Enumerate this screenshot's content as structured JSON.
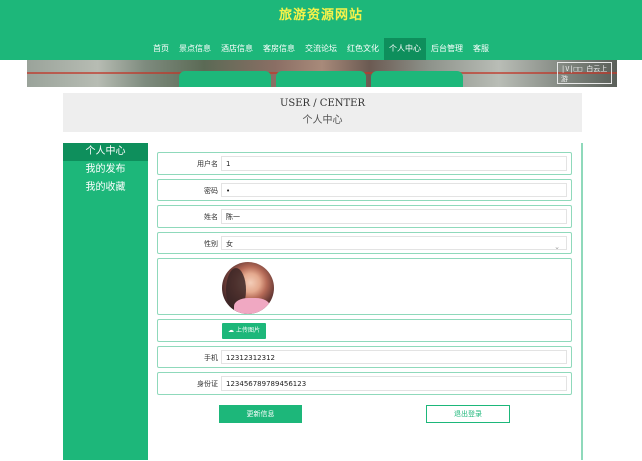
{
  "site": {
    "title": "旅游资源网站"
  },
  "nav": {
    "items": [
      "首页",
      "景点信息",
      "酒店信息",
      "客房信息",
      "交流论坛",
      "红色文化",
      "个人中心",
      "后台管理",
      "客服"
    ],
    "active_index": 6
  },
  "banner": {
    "stamp_text": "|V|□□ 白云上游"
  },
  "section": {
    "title_en": "USER / CENTER",
    "title_zh": "个人中心"
  },
  "sidebar": {
    "items": [
      "个人中心",
      "我的发布",
      "我的收藏"
    ],
    "active_index": 0
  },
  "form": {
    "username": {
      "label": "用户名",
      "value": "1"
    },
    "password": {
      "label": "密码",
      "value": "•"
    },
    "name": {
      "label": "姓名",
      "value": "陈一"
    },
    "gender": {
      "label": "性别",
      "value": "女"
    },
    "upload": {
      "label": "上传图片",
      "icon": "cloud-upload-icon"
    },
    "phone": {
      "label": "手机",
      "value": "12312312312"
    },
    "id_card": {
      "label": "身份证",
      "value": "123456789789456123"
    }
  },
  "actions": {
    "update_label": "更新信息",
    "logout_label": "退出登录"
  },
  "colors": {
    "brand": "#1db77a",
    "brand_dark": "#0e8f5c",
    "title_yellow": "#f6f24a",
    "border_light": "#8fd9bb"
  }
}
